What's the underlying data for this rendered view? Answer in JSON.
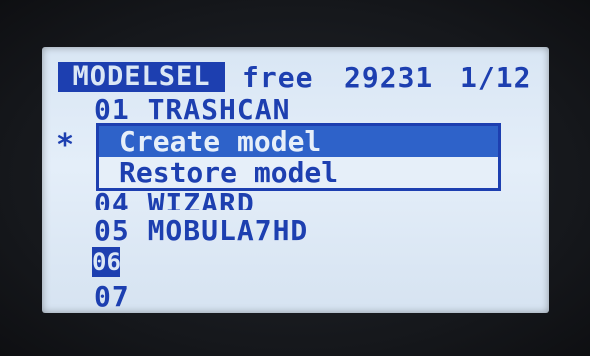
{
  "header": {
    "title": "MODELSEL",
    "free_label": "free",
    "free_value": "29231",
    "page": "1/12"
  },
  "models": [
    {
      "label": "01 TRASHCAN"
    },
    {
      "label": "04 WIZARD"
    },
    {
      "label": "05 MOBULA7HD"
    },
    {
      "label": "06"
    },
    {
      "label": "07"
    }
  ],
  "current_marker": "*",
  "popup": {
    "items": [
      {
        "label": "Create model",
        "selected": true
      },
      {
        "label": "Restore model",
        "selected": false
      }
    ]
  }
}
